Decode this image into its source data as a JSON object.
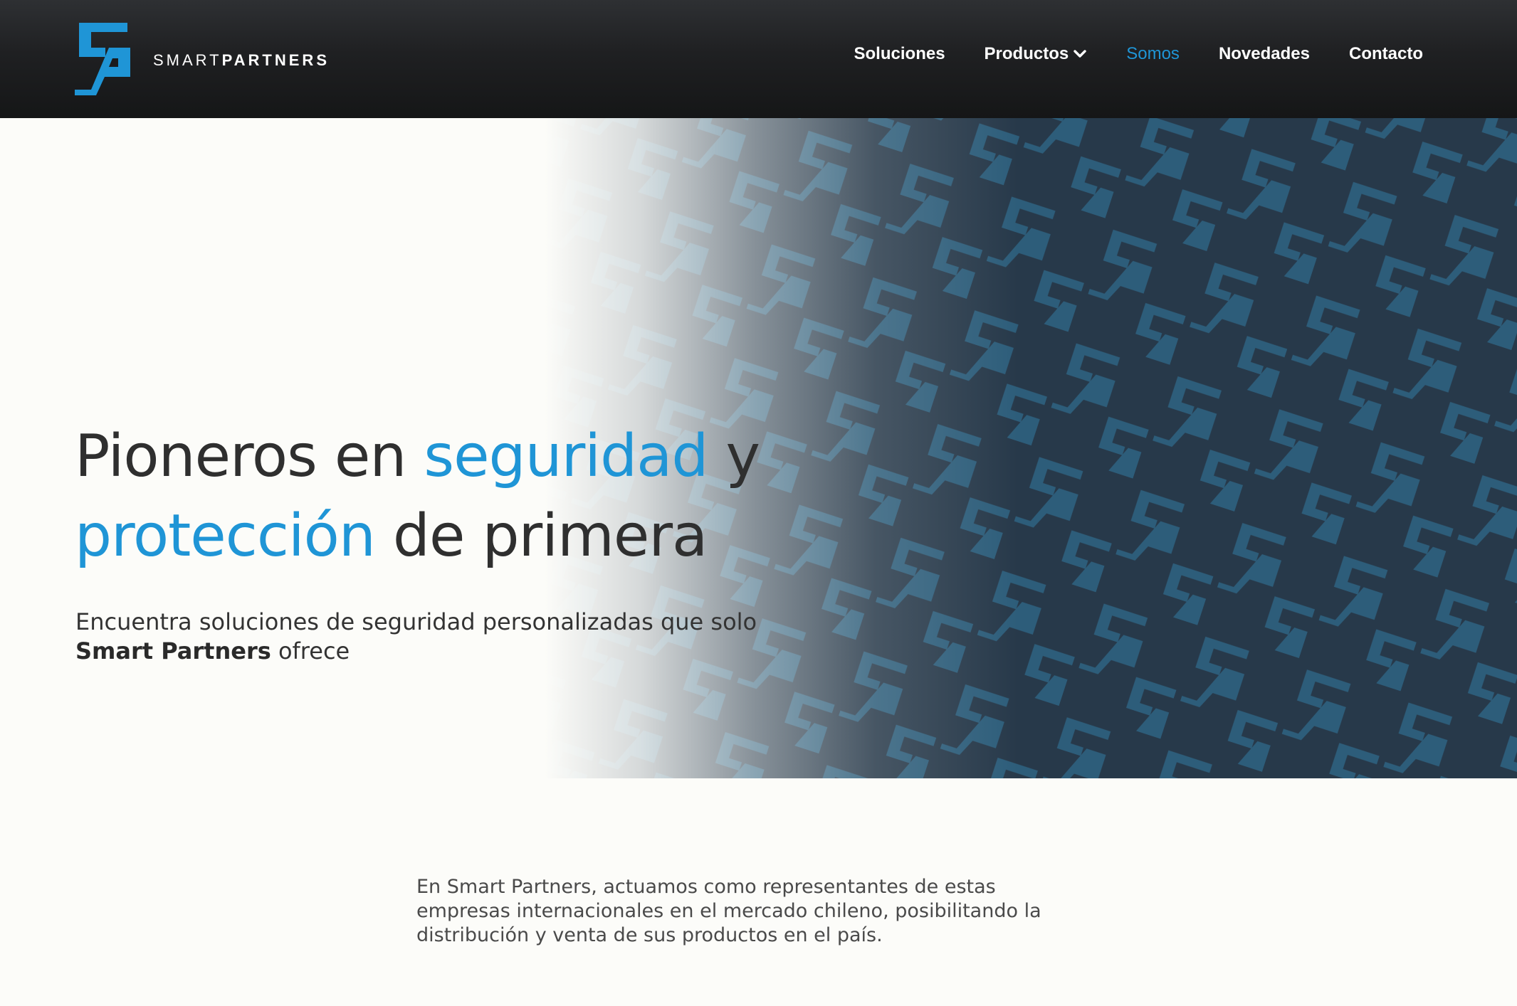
{
  "brand": {
    "name_light": "SMART",
    "name_bold": "PARTNERS",
    "logo_icon": "sp-monogram-icon",
    "accent_color": "#1f95d6",
    "pattern_color": "#27394a"
  },
  "nav": {
    "items": [
      {
        "label": "Soluciones",
        "active": false
      },
      {
        "label": "Productos",
        "active": false,
        "has_dropdown": true,
        "dropdown_icon": "chevron-down-icon"
      },
      {
        "label": "Somos",
        "active": true
      },
      {
        "label": "Novedades",
        "active": false
      },
      {
        "label": "Contacto",
        "active": false
      }
    ]
  },
  "hero": {
    "title_part1": "Pioneros en ",
    "title_accent1": "seguridad",
    "title_part2": " y",
    "title_accent2": "protección",
    "title_part3": " de primera",
    "subtitle_line1": "Encuentra soluciones de seguridad personalizadas que solo",
    "subtitle_bold": "Smart Partners",
    "subtitle_tail": " ofrece"
  },
  "about": {
    "text": "En Smart Partners, actuamos como representantes de estas empresas internacionales en el mercado chileno, posibilitando la distribución y venta de sus productos en el país."
  }
}
